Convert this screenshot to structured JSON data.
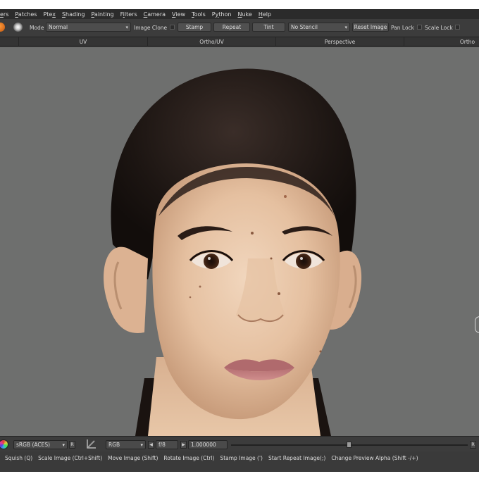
{
  "menu": {
    "items": [
      {
        "label": "ers",
        "key": "e"
      },
      {
        "label": "Patches",
        "key": "P"
      },
      {
        "label": "Ptex",
        "key": "x"
      },
      {
        "label": "Shading",
        "key": "S"
      },
      {
        "label": "Painting",
        "key": "P"
      },
      {
        "label": "Filters",
        "key": "i"
      },
      {
        "label": "Camera",
        "key": "C"
      },
      {
        "label": "View",
        "key": "V"
      },
      {
        "label": "Tools",
        "key": "T"
      },
      {
        "label": "Python",
        "key": "y"
      },
      {
        "label": "Nuke",
        "key": "N"
      },
      {
        "label": "Help",
        "key": "H"
      }
    ]
  },
  "toolbar": {
    "mode_label": "Mode",
    "mode_value": "Normal",
    "image_clone_label": "Image Clone",
    "stamp_label": "Stamp",
    "repeat_label": "Repeat",
    "tint_label": "Tint",
    "stencil_value": "No Stencil",
    "reset_image_label": "Reset Image",
    "pan_lock_label": "Pan Lock",
    "scale_lock_label": "Scale Lock"
  },
  "view_tabs": [
    "UV",
    "Ortho/UV",
    "Perspective",
    "Ortho"
  ],
  "statusbar": {
    "colorspace_value": "sRGB (ACES)",
    "colorspace_reset": "R",
    "channel_value": "RGB",
    "fstop_value": "f/8",
    "exposure_value": "1.000000",
    "right_reset": "R",
    "slider_position": 0.5
  },
  "hints": [
    "Squish (Q)",
    "Scale Image (Ctrl+Shift)",
    "Move Image (Shift)",
    "Rotate Image (Ctrl)",
    "Stamp Image (')",
    "Start Repeat Image(;)",
    "Change Preview Alpha (Shift -/+)"
  ],
  "colors": {
    "viewport_bg": "#6e6f6e",
    "panel_bg": "#3a3a3a",
    "menubar_bg": "#2b2b2b",
    "text": "#dcdcdc"
  }
}
